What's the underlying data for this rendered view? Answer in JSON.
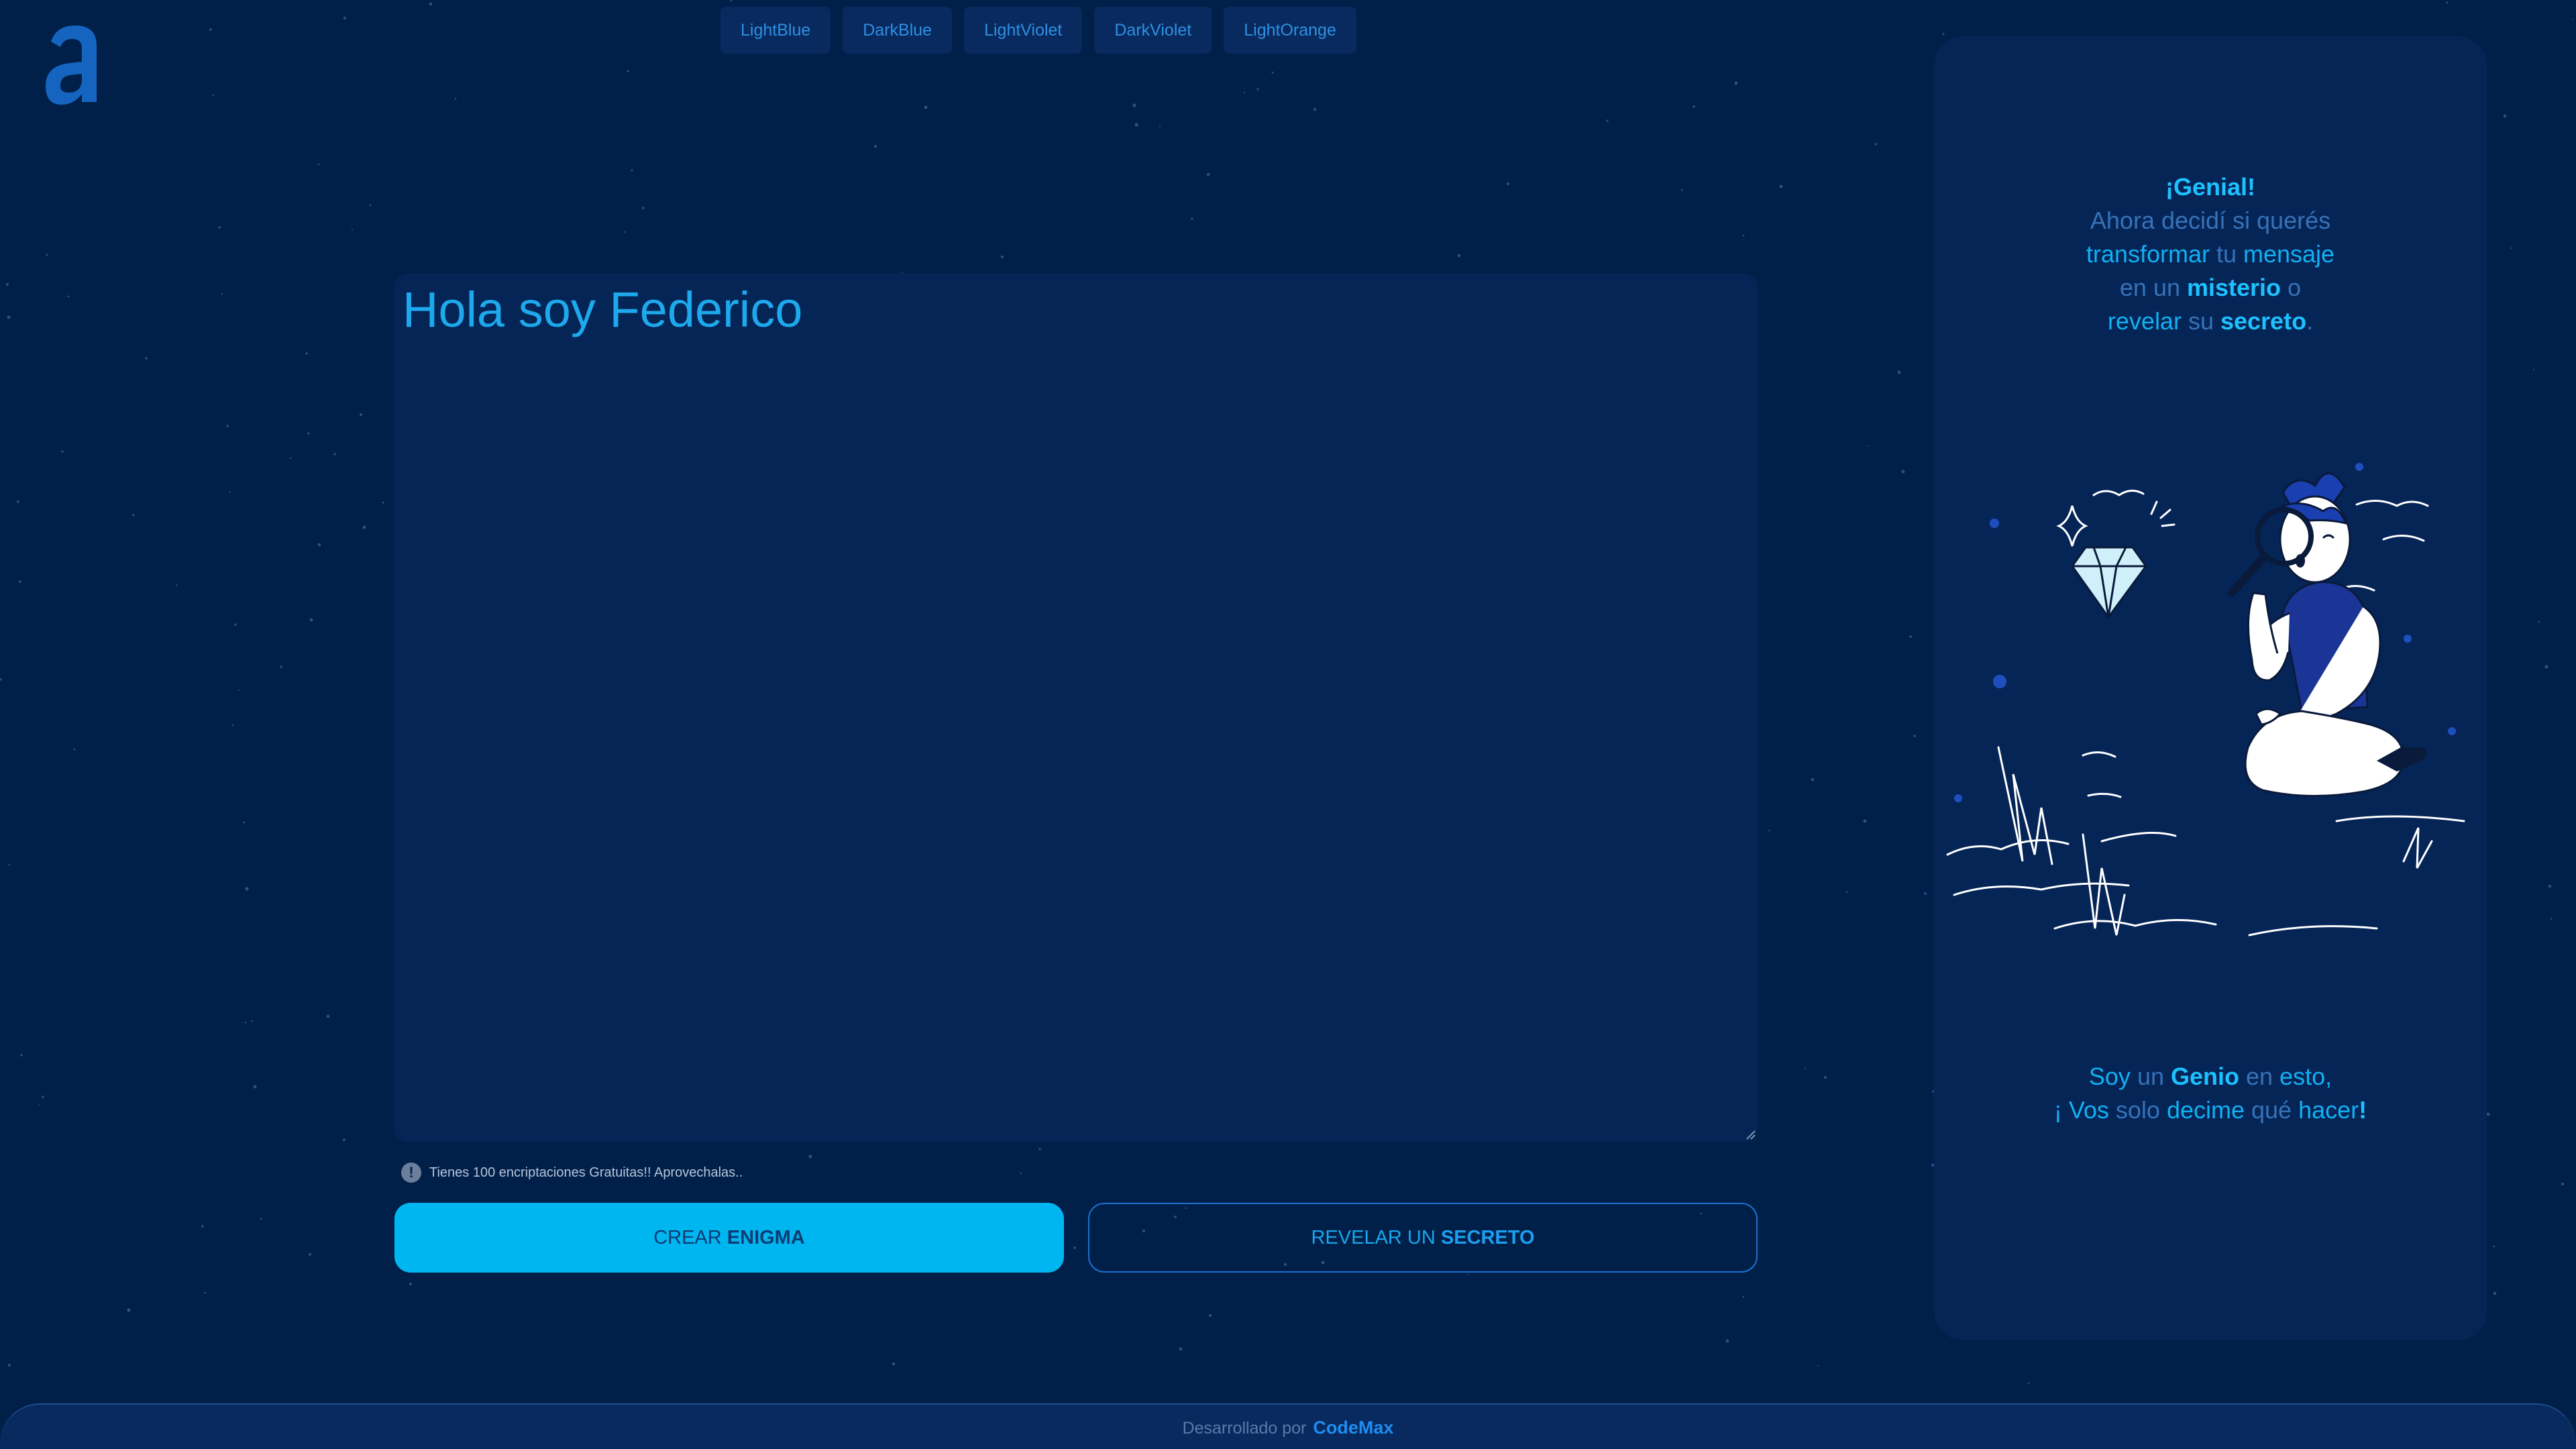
{
  "themes": [
    "LightBlue",
    "DarkBlue",
    "LightViolet",
    "DarkViolet",
    "LightOrange"
  ],
  "editor": {
    "value": "Hola soy Federico"
  },
  "notice": {
    "icon": "exclamation-icon",
    "text": "Tienes 100 encriptaciones Gratuitas!! Aprovechalas.."
  },
  "buttons": {
    "encrypt": {
      "prefix": "CREAR ",
      "bold": "ENIGMA"
    },
    "decrypt": {
      "prefix": "REVELAR UN ",
      "bold": "SECRETO"
    }
  },
  "panel": {
    "line1": "¡Genial!",
    "line2": "Ahora decidí si querés",
    "line3": {
      "a": "transformar",
      "b": " tu ",
      "c": "mensaje"
    },
    "line4": {
      "a": "en un ",
      "b": "misterio",
      "c": " o"
    },
    "line5": {
      "a": "revelar",
      "b": " su ",
      "c": "secreto",
      "d": "."
    },
    "bottom1": {
      "a": "Soy",
      "b": " un ",
      "c": "Genio",
      "d": " en ",
      "e": "esto,"
    },
    "bottom2": {
      "a": "¡ ",
      "b": "Vos",
      "c": " solo ",
      "d": "decime",
      "e": " qué ",
      "f": "hacer",
      "g": "!"
    }
  },
  "footer": {
    "text": "Desarrollado por",
    "brand": "CodeMax"
  },
  "colors": {
    "background": "#00204a",
    "panel": "#052557",
    "accent": "#00b6f0",
    "link": "#1e8df2"
  }
}
